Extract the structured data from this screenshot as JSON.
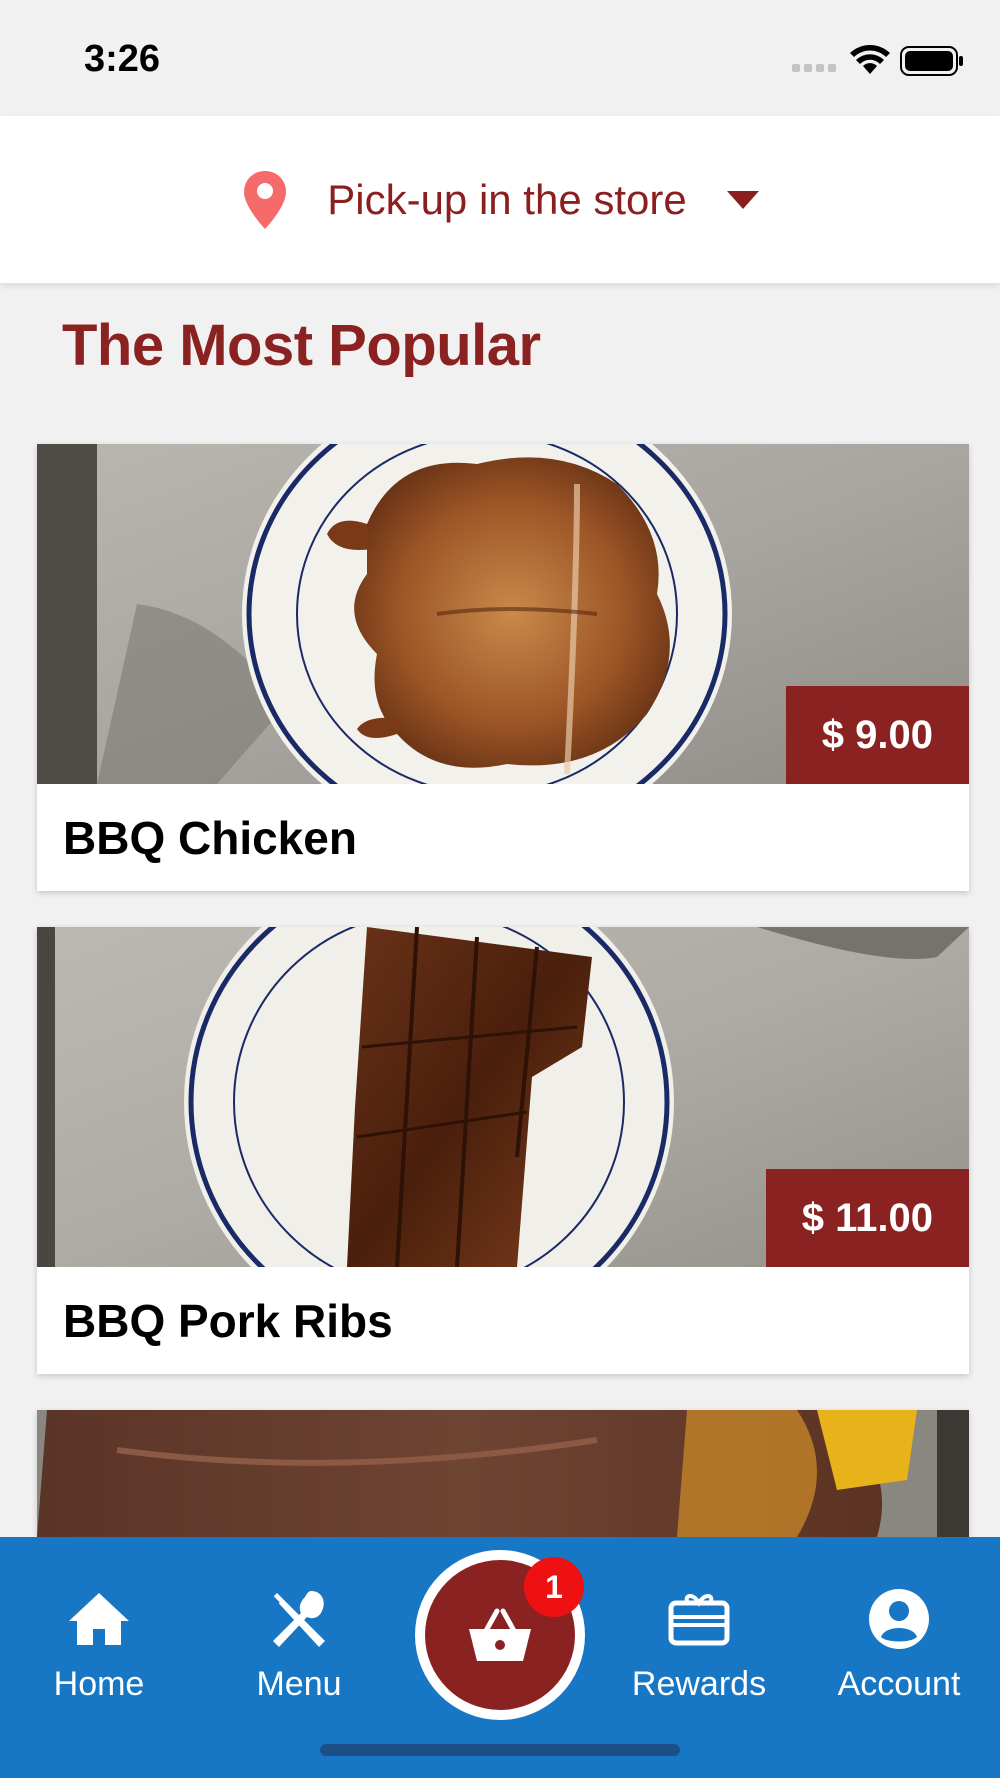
{
  "status": {
    "time": "3:26"
  },
  "location": {
    "label": "Pick-up in the store"
  },
  "section": {
    "title": "The Most Popular"
  },
  "items": [
    {
      "name": "BBQ Chicken",
      "price": "$ 9.00"
    },
    {
      "name": "BBQ Pork Ribs",
      "price": "$ 11.00"
    }
  ],
  "tabs": {
    "home": "Home",
    "menu": "Menu",
    "rewards": "Rewards",
    "account": "Account"
  },
  "cart": {
    "count": "1"
  },
  "colors": {
    "brand": "#8b2222",
    "tab_bar": "#1877c4",
    "badge": "#ee1111"
  }
}
